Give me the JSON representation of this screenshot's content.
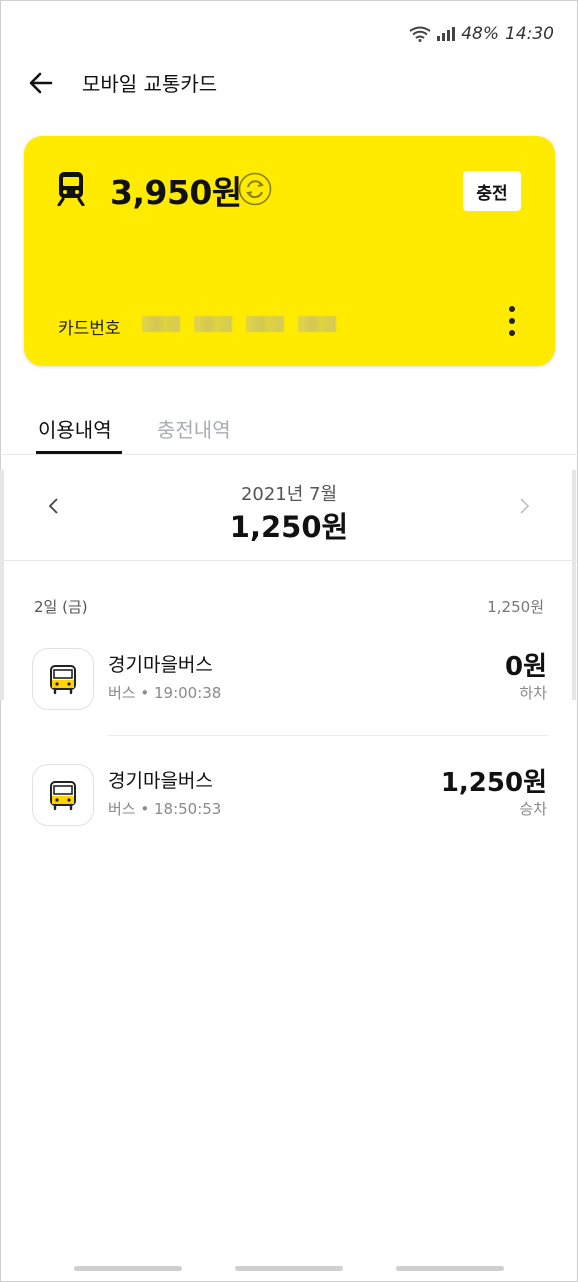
{
  "status_bar": {
    "battery": "48%",
    "time": "14:30"
  },
  "header": {
    "title": "모바일 교통카드"
  },
  "card": {
    "balance": "3,950원",
    "charge_label": "충전",
    "card_number_label": "카드번호",
    "color": "#ffeb00"
  },
  "tabs": [
    {
      "label": "이용내역",
      "active": true
    },
    {
      "label": "충전내역",
      "active": false
    }
  ],
  "month": {
    "label": "2021년 7월",
    "total": "1,250원"
  },
  "day": {
    "label": "2일 (금)",
    "amount": "1,250원"
  },
  "transactions": [
    {
      "name": "경기마을버스",
      "sub": "버스 • 19:00:38",
      "amount": "0원",
      "kind": "하차"
    },
    {
      "name": "경기마을버스",
      "sub": "버스 • 18:50:53",
      "amount": "1,250원",
      "kind": "승차"
    }
  ]
}
